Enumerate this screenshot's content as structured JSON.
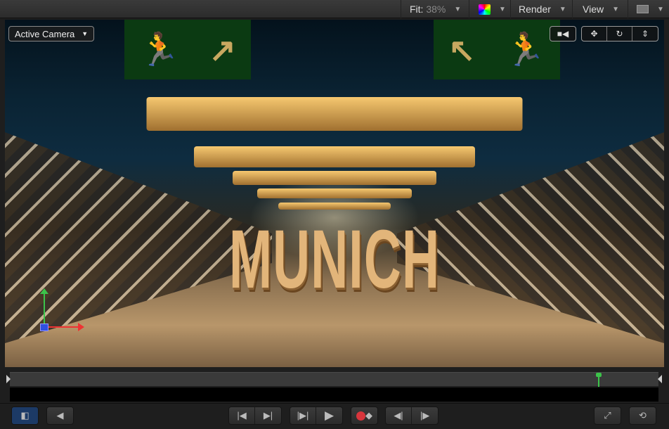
{
  "toolbar": {
    "fit_label": "Fit:",
    "fit_value": "38%",
    "color_icon": "color-channels-icon",
    "render": "Render",
    "view": "View",
    "layout_icon": "layout-icon"
  },
  "canvas": {
    "camera_menu": "Active Camera",
    "title_text": "MUNICH",
    "tools": [
      "camera-icon",
      "pan-icon",
      "orbit-icon",
      "dolly-icon"
    ]
  },
  "timeline": {
    "playhead_fraction": 0.907
  },
  "transport": {
    "buttons": [
      "show-hide-panels",
      "audio",
      "go-to-start",
      "go-to-end",
      "play-from-start",
      "play",
      "record",
      "previous-keyframe",
      "next-keyframe",
      "full-screen",
      "loop"
    ]
  },
  "colors": {
    "accent_green": "#3cc34a",
    "record_red": "#d8353c"
  }
}
